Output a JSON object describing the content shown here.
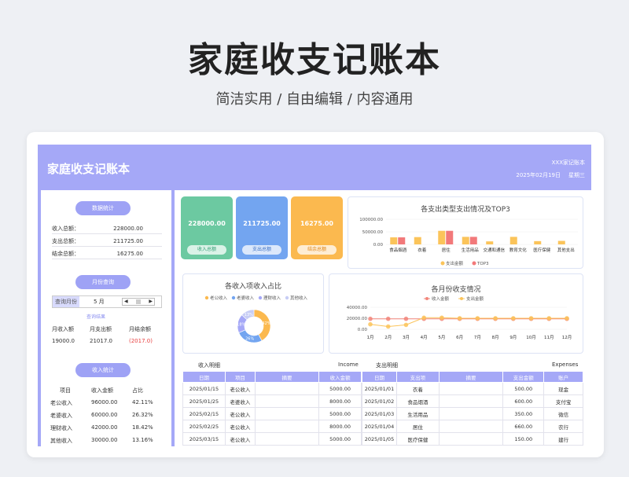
{
  "hero": {
    "title": "家庭收支记账本",
    "subtitle": "简洁实用 / 自由编辑 / 内容通用"
  },
  "app": {
    "title": "家庭收支记账本",
    "owner": "XXX家记账本",
    "date": "2025年02月19日",
    "weekday": "星期三"
  },
  "sidebar": {
    "data_stats": {
      "title": "数据统计",
      "rows": [
        {
          "label": "收入总额：",
          "value": "228000.00"
        },
        {
          "label": "支出总额：",
          "value": "211725.00"
        },
        {
          "label": "结余总额：",
          "value": "16275.00"
        }
      ]
    },
    "month_query": {
      "title": "月份查询",
      "select_label": "查询月份",
      "month_value": "5 月",
      "spin_left": "◀",
      "spin_right": "▶",
      "result_link": "查询结果",
      "headers": [
        "月收入额",
        "月支出额",
        "月结余额"
      ],
      "values": [
        "19000.0",
        "21017.0",
        "(2017.0)"
      ]
    },
    "income_stats": {
      "title": "收入统计",
      "headers": [
        "项目",
        "收入金额",
        "占比"
      ],
      "rows": [
        [
          "老公收入",
          "96000.00",
          "42.11%"
        ],
        [
          "老婆收入",
          "60000.00",
          "26.32%"
        ],
        [
          "理财收入",
          "42000.00",
          "18.42%"
        ],
        [
          "其他收入",
          "30000.00",
          "13.16%"
        ]
      ]
    }
  },
  "cards": [
    {
      "amount": "228000.00",
      "label": "收入总额",
      "color": "#6cc9a1",
      "btn_color": "#3aa37a"
    },
    {
      "amount": "211725.00",
      "label": "支出总额",
      "color": "#73a5f0",
      "btn_color": "#3f73c7"
    },
    {
      "amount": "16275.00",
      "label": "结余总额",
      "color": "#fbb94f",
      "btn_color": "#e0881c"
    }
  ],
  "colors": {
    "accent": "#a5a8f7",
    "bar_total": "#fbc45a",
    "bar_top3": "#f2797a",
    "income_line": "#f2857a",
    "expense_line": "#fbc45a",
    "donut": [
      "#fbb94f",
      "#73a5f0",
      "#a5a8f7",
      "#c7cdf5"
    ]
  },
  "chart_data": [
    {
      "type": "bar",
      "title": "各支出类型支出情况及TOP3",
      "categories": [
        "食品烟酒",
        "衣着",
        "居住",
        "生活用品",
        "交通和通信",
        "教育文化",
        "医疗保健",
        "其他支出"
      ],
      "series": [
        {
          "name": "支出金额",
          "values": [
            28000,
            29000,
            54000,
            30000,
            12000,
            30000,
            13000,
            14000
          ]
        },
        {
          "name": "TOP3",
          "values": [
            28000,
            0,
            54000,
            30000,
            0,
            0,
            0,
            0
          ]
        }
      ],
      "y_ticks": [
        "100000.00",
        "50000.00",
        "0.00"
      ],
      "ylim": [
        0,
        100000
      ]
    },
    {
      "type": "pie",
      "title": "各收入项收入占比",
      "categories": [
        "老公收入",
        "老婆收入",
        "理财收入",
        "其他收入"
      ],
      "values": [
        42.11,
        26.32,
        18.42,
        13.16
      ],
      "data_labels": [
        "42%",
        "26%",
        "18%",
        "13%"
      ]
    },
    {
      "type": "line",
      "title": "各月份收支情况",
      "categories": [
        "1月",
        "2月",
        "3月",
        "4月",
        "5月",
        "6月",
        "7月",
        "8月",
        "9月",
        "10月",
        "11月",
        "12月"
      ],
      "series": [
        {
          "name": "收入金额",
          "values": [
            19000,
            19000,
            19000,
            19000,
            19000,
            19000,
            19000,
            19000,
            19000,
            19000,
            19000,
            19000
          ]
        },
        {
          "name": "支出金额",
          "values": [
            9000,
            5000,
            8000,
            21000,
            21017,
            20000,
            20000,
            20000,
            20000,
            20000,
            20000,
            20000
          ]
        }
      ],
      "y_ticks": [
        "40000.00",
        "20000.00",
        "0.00"
      ],
      "ylim": [
        0,
        40000
      ]
    }
  ],
  "tables": {
    "income_label": "收入明细",
    "income_en": "Income",
    "expense_label": "支出明细",
    "expense_en": "Expenses",
    "income_headers": [
      "日期",
      "项目",
      "摘要",
      "收入金额"
    ],
    "expense_headers": [
      "日期",
      "支出项",
      "摘要",
      "支出金额",
      "账户"
    ],
    "income_rows": [
      [
        "2025/01/15",
        "老公收入",
        "",
        "5000.00"
      ],
      [
        "2025/01/25",
        "老婆收入",
        "",
        "8000.00"
      ],
      [
        "2025/02/15",
        "老公收入",
        "",
        "5000.00"
      ],
      [
        "2025/02/25",
        "老公收入",
        "",
        "8000.00"
      ],
      [
        "2025/03/15",
        "老公收入",
        "",
        "5000.00"
      ]
    ],
    "expense_rows": [
      [
        "2025/01/01",
        "衣着",
        "",
        "500.00",
        "现金"
      ],
      [
        "2025/01/02",
        "食品烟酒",
        "",
        "600.00",
        "支付宝"
      ],
      [
        "2025/01/03",
        "生活用品",
        "",
        "350.00",
        "微信"
      ],
      [
        "2025/01/04",
        "居住",
        "",
        "660.00",
        "农行"
      ],
      [
        "2025/01/05",
        "医疗保健",
        "",
        "150.00",
        "建行"
      ]
    ]
  }
}
